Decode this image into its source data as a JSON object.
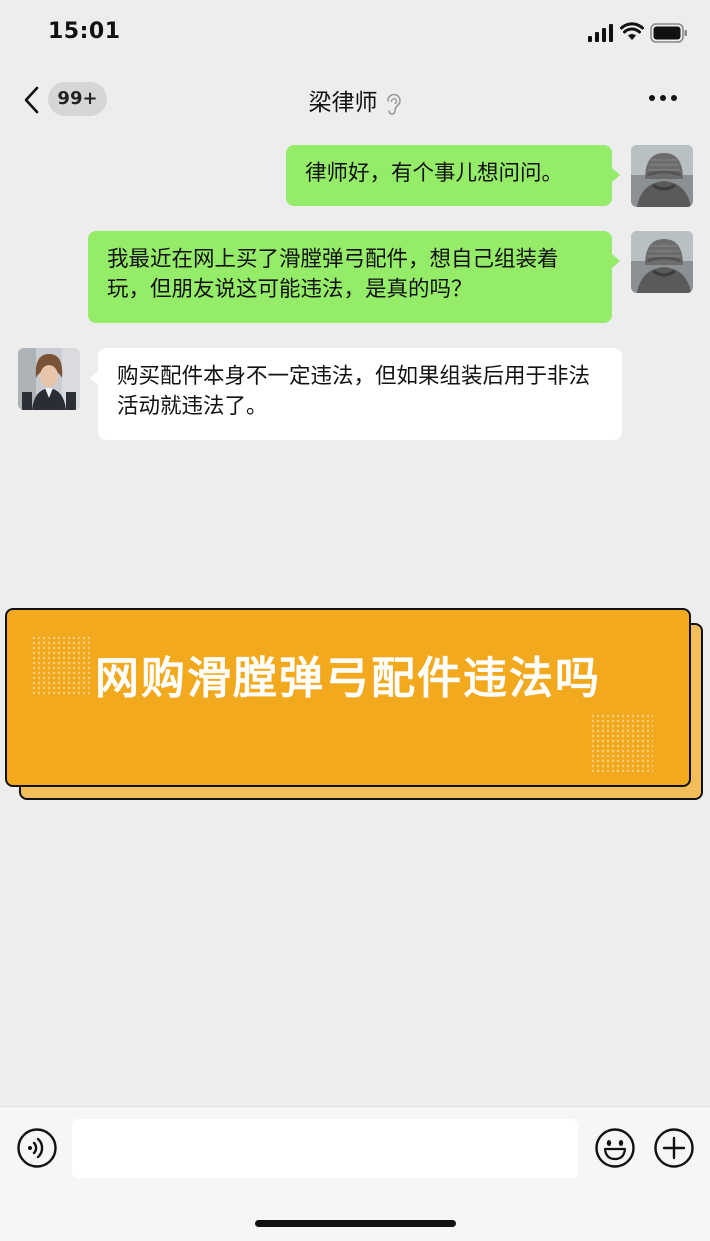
{
  "status_bar": {
    "time": "15:01"
  },
  "nav": {
    "unread_badge": "99+",
    "title": "梁律师"
  },
  "messages": [
    {
      "sender": "me",
      "text": "律师好，有个事儿想问问。"
    },
    {
      "sender": "me",
      "text": "我最近在网上买了滑膛弹弓配件，想自己组装着玩，但朋友说这可能违法，是真的吗？"
    },
    {
      "sender": "lawyer",
      "text": "购买配件本身不一定违法，但如果组装后用于非法活动就违法了。"
    }
  ],
  "banner": {
    "title": "网购滑膛弹弓配件违法吗"
  },
  "input_bar": {
    "placeholder": ""
  },
  "colors": {
    "my_bubble": "#95ec69",
    "other_bubble": "#ffffff",
    "banner": "#f2a91e",
    "banner_shadow": "#f3bd5a",
    "background": "#ededed"
  },
  "icons": [
    "signal-icon",
    "wifi-icon",
    "battery-icon",
    "back-icon",
    "ear-icon",
    "more-icon",
    "voice-icon",
    "emoji-icon",
    "plus-icon"
  ]
}
